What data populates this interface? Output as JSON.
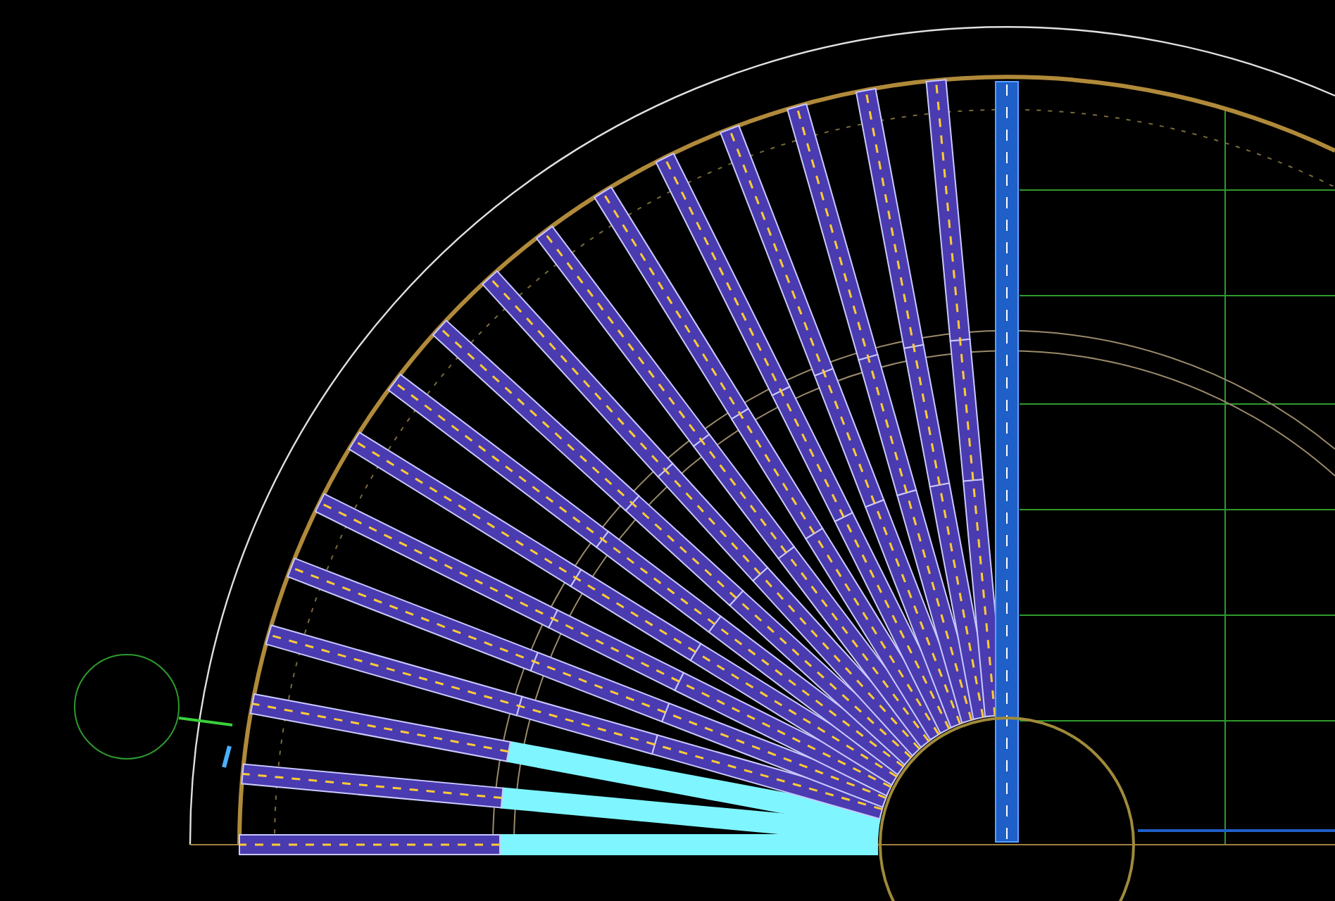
{
  "drawing": {
    "spokes": [
      {
        "kind": "radial",
        "selected": true
      },
      {
        "kind": "radial",
        "selected": true
      },
      {
        "kind": "radial",
        "selected": true
      },
      {
        "kind": "radial",
        "selected": false
      },
      {
        "kind": "radial",
        "selected": false
      },
      {
        "kind": "radial",
        "selected": false
      },
      {
        "kind": "radial",
        "selected": false
      },
      {
        "kind": "radial",
        "selected": false
      },
      {
        "kind": "radial",
        "selected": false
      },
      {
        "kind": "radial",
        "selected": false
      },
      {
        "kind": "radial",
        "selected": false
      },
      {
        "kind": "radial",
        "selected": false
      },
      {
        "kind": "radial",
        "selected": false
      },
      {
        "kind": "radial",
        "selected": false
      },
      {
        "kind": "radial",
        "selected": false
      },
      {
        "kind": "radial",
        "selected": false
      },
      {
        "kind": "radial",
        "selected": false
      },
      {
        "kind": "vertical",
        "selected": false
      }
    ]
  }
}
